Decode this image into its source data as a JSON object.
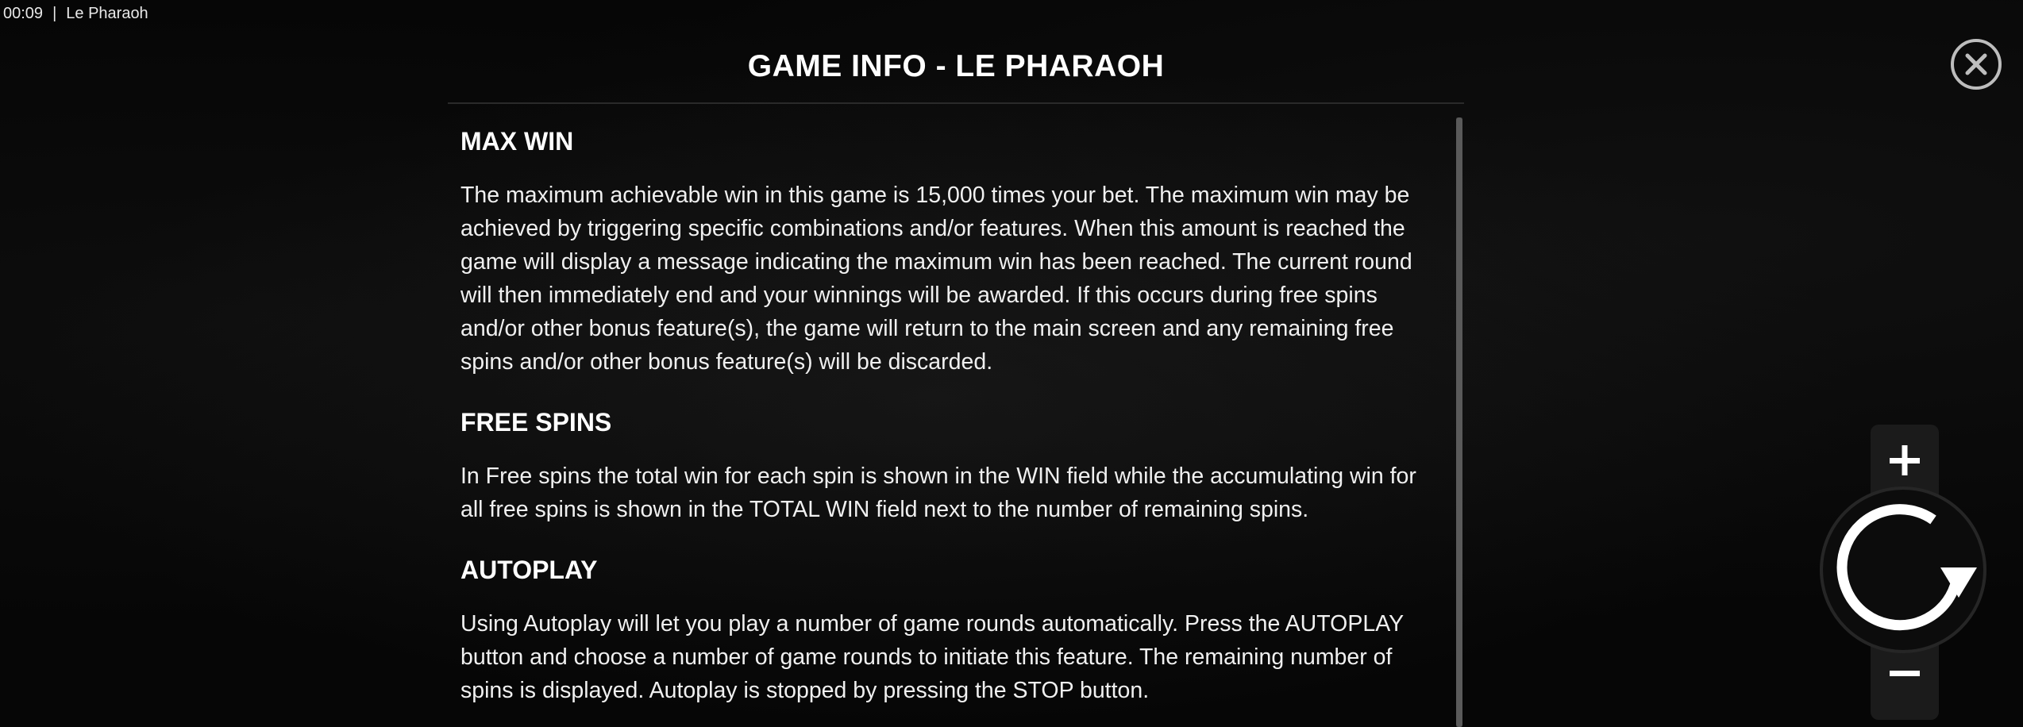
{
  "status_bar": {
    "time": "00:09",
    "separator": "|",
    "game_name": "Le Pharaoh"
  },
  "dialog": {
    "title": "GAME INFO - LE PHARAOH",
    "sections": [
      {
        "heading": "MAX WIN",
        "body": "The maximum achievable win in this game is 15,000 times your bet. The maximum win may be achieved by triggering specific combinations and/or features. When this amount is reached the game will display a message indicating the maximum win has been reached. The current round will then immediately end and your winnings will be awarded. If this occurs during free spins and/or other bonus feature(s), the game will return to the main screen and any remaining free spins and/or other bonus feature(s) will be discarded."
      },
      {
        "heading": "FREE SPINS",
        "body": "In Free spins the total win for each spin is shown in the WIN field while the accumulating win for all free spins is shown in the TOTAL WIN field next to the number of remaining spins."
      },
      {
        "heading": "AUTOPLAY",
        "body": "Using Autoplay will let you play a number of game rounds automatically. Press the AUTOPLAY button and choose a number of game rounds to initiate this feature. The remaining number of spins is displayed. Autoplay is stopped by pressing the STOP button."
      }
    ]
  },
  "icons": {
    "close": "close-icon",
    "plus": "plus-icon",
    "minus": "minus-icon",
    "spin": "spin-icon"
  },
  "colors": {
    "background": "#060606",
    "text": "#ffffff",
    "close_ring": "#bdbdbd",
    "control_bg": "#1b1b1b"
  }
}
